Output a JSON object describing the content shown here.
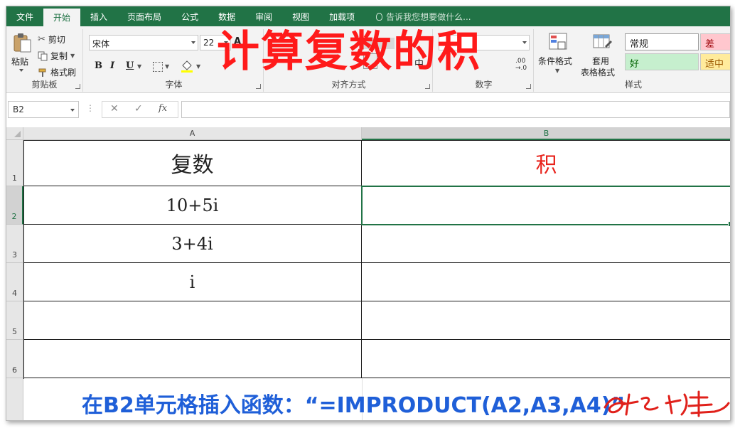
{
  "tabs": [
    {
      "label": "文件",
      "active": false
    },
    {
      "label": "开始",
      "active": true
    },
    {
      "label": "插入",
      "active": false
    },
    {
      "label": "页面布局",
      "active": false
    },
    {
      "label": "公式",
      "active": false
    },
    {
      "label": "数据",
      "active": false
    },
    {
      "label": "审阅",
      "active": false
    },
    {
      "label": "视图",
      "active": false
    },
    {
      "label": "加载项",
      "active": false
    }
  ],
  "tell_me": "告诉我您想要做什么...",
  "clipboard": {
    "paste": "粘贴",
    "cut": "剪切",
    "copy": "复制",
    "format_painter": "格式刷",
    "label": "剪贴板"
  },
  "font": {
    "name": "宋体",
    "size": "22",
    "bold": "B",
    "italic": "I",
    "underline": "U",
    "label": "字体"
  },
  "alignment": {
    "merge_center_tail": "中",
    "label": "对齐方式"
  },
  "number": {
    "label": "数字"
  },
  "styles": {
    "conditional_format": "条件格式",
    "table_format_1": "套用",
    "table_format_2": "表格格式",
    "normal": "常规",
    "bad": "差",
    "good": "好",
    "neutral": "适中",
    "label": "样式",
    "colors": {
      "bad_bg": "#ffc7ce",
      "bad_fg": "#9c0006",
      "good_bg": "#c6efce",
      "good_fg": "#006100",
      "neutral_bg": "#ffeb9c",
      "neutral_fg": "#9c5700"
    }
  },
  "overlay_title": "计算复数的积",
  "name_box": "B2",
  "formula_bar": {
    "fx": "fx",
    "content": ""
  },
  "columns": [
    "A",
    "B"
  ],
  "rows": [
    "1",
    "2",
    "3",
    "4",
    "5",
    "6"
  ],
  "cells": {
    "A1": "复数",
    "B1": "积",
    "A2": "10+5i",
    "A3": "3+4i",
    "A4": "i",
    "B2": "",
    "B3": "",
    "B4": "",
    "A5": "",
    "B5": "",
    "A6": "",
    "B6": ""
  },
  "instruction": "在B2单元格插入函数：“=IMPRODUCT(A2,A3,A4)”",
  "theme": {
    "excel_green": "#217346",
    "title_red": "#ff1a1a",
    "instruction_blue": "#1f5fd8",
    "header_red": "#e8231c"
  }
}
